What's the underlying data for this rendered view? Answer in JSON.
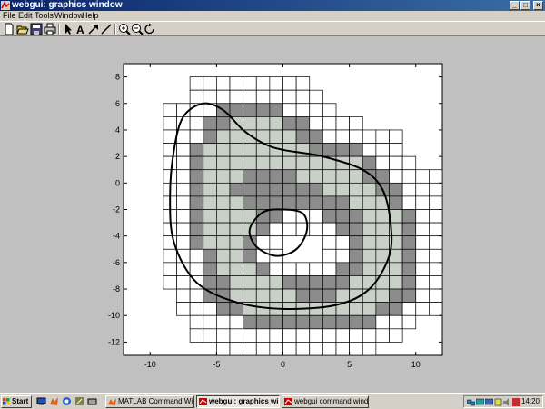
{
  "window": {
    "title": "webgui: graphics window"
  },
  "menu": [
    "File",
    "Edit",
    "Tools",
    "Window",
    "Help"
  ],
  "toolbar": [
    "new-icon",
    "open-icon",
    "save-icon",
    "print-icon",
    "pointer-icon",
    "text-icon",
    "arrow-icon",
    "line-icon",
    "zoom-in-icon",
    "zoom-out-icon",
    "rotate-icon"
  ],
  "taskbar": {
    "start_label": "Start",
    "tasks": [
      "MATLAB Command Window",
      "webgui: graphics win...",
      "webgui command window ..."
    ],
    "clock": "14:20"
  },
  "colors": {
    "light_cell": "#c8d0c8",
    "dark_cell": "#8c8c8c",
    "empty_cell": "#ffffff",
    "grid": "#000000",
    "background": "#c0c0c0"
  },
  "chart_data": {
    "type": "heatmap",
    "title": "",
    "xlabel": "",
    "ylabel": "",
    "xlim": [
      -12,
      12
    ],
    "ylim": [
      -13,
      9
    ],
    "xticks": [
      -10,
      -5,
      0,
      5,
      10
    ],
    "yticks": [
      -12,
      -10,
      -8,
      -6,
      -4,
      -2,
      0,
      2,
      4,
      6,
      8
    ],
    "grid_origin": {
      "x": -12,
      "y": 9
    },
    "cell_size": 1,
    "cell_legend": {
      "0": "empty",
      "1": "white",
      "2": "dark gray",
      "3": "light gray"
    },
    "cells": [
      "000000000000000000000000",
      "000001111111110000000000",
      "000001111111111000000000",
      "000111122222111100000000",
      "000111223333221111000000",
      "000111233333322111111000",
      "000112333333332222111000",
      "000112333333333333211100",
      "000112333222233333221111",
      "000112332222222333322111",
      "000112333222222223332111",
      "000112333322111222333211",
      "000112333321111122333211",
      "000112333211000112333211",
      "000111233211000112333211",
      "000111233321111122333211",
      "000111223333222223333211",
      "000011223333322233332211",
      "000011122333333333322111",
      "000001111222222222211100",
      "000001111111111111111000",
      "000000011111111111100000"
    ],
    "contours": [
      {
        "name": "outer",
        "points": [
          [
            -7.5,
            5
          ],
          [
            -6,
            6
          ],
          [
            -4.5,
            5.5
          ],
          [
            -3,
            4
          ],
          [
            -1.5,
            3
          ],
          [
            0,
            2.5
          ],
          [
            3,
            2
          ],
          [
            6,
            1
          ],
          [
            7.5,
            -0.5
          ],
          [
            8.1,
            -3
          ],
          [
            8,
            -5.5
          ],
          [
            6.5,
            -8
          ],
          [
            4,
            -9.2
          ],
          [
            0,
            -9.5
          ],
          [
            -3.5,
            -9
          ],
          [
            -6.5,
            -7.5
          ],
          [
            -8.2,
            -4.5
          ],
          [
            -8.5,
            -1
          ],
          [
            -8.2,
            2.5
          ]
        ]
      },
      {
        "name": "inner",
        "points": [
          [
            -2.5,
            -3.5
          ],
          [
            -1.5,
            -2.2
          ],
          [
            0,
            -2
          ],
          [
            1.5,
            -2.3
          ],
          [
            1.8,
            -3.6
          ],
          [
            1,
            -5
          ],
          [
            -0.5,
            -5.5
          ],
          [
            -2,
            -4.8
          ]
        ]
      }
    ]
  }
}
